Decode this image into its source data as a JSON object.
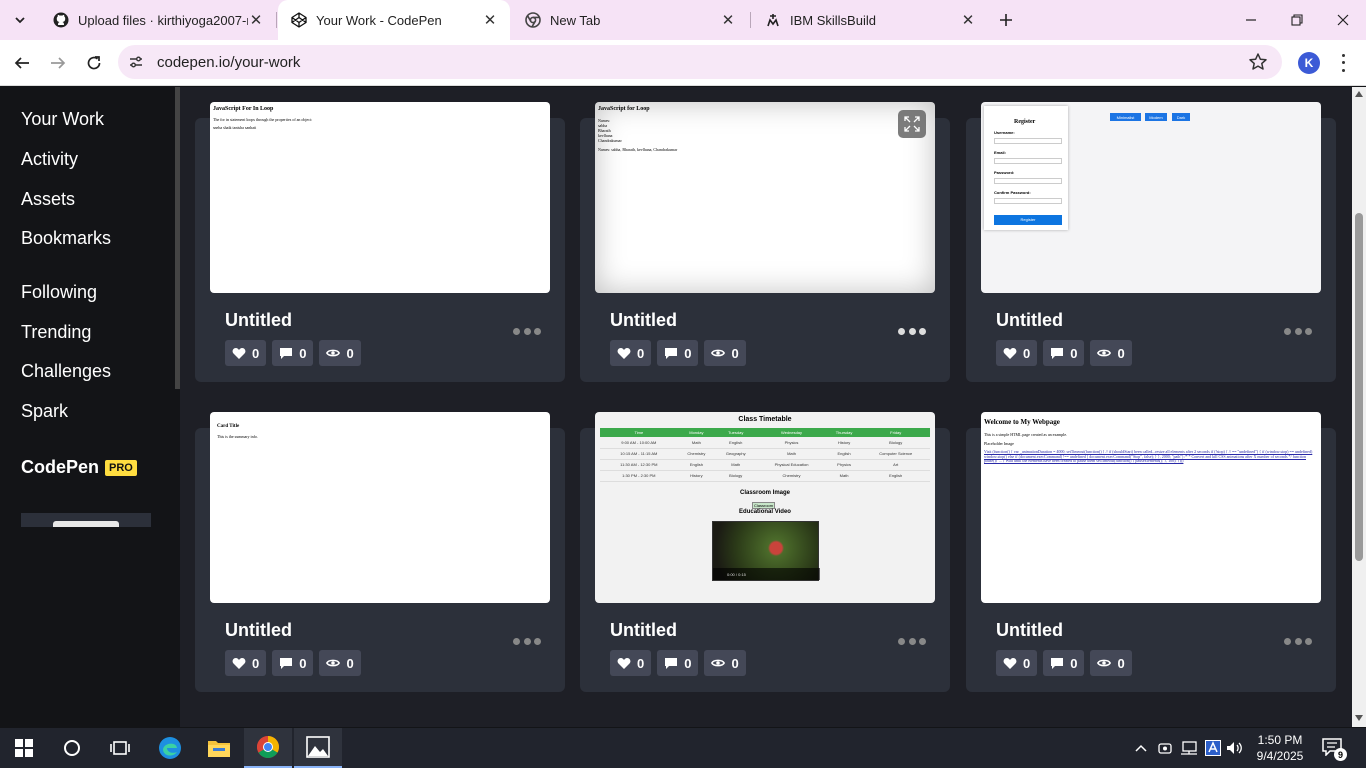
{
  "browser": {
    "tabs": [
      {
        "title": "Upload files · kirthiyoga2007-m",
        "icon": "github-icon",
        "active": false
      },
      {
        "title": "Your Work - CodePen",
        "icon": "codepen-icon",
        "active": true
      },
      {
        "title": "New Tab",
        "icon": "chrome-icon",
        "active": false
      },
      {
        "title": "IBM SkillsBuild",
        "icon": "ibm-skillsbuild-icon",
        "active": false
      }
    ],
    "close_glyph": "✕",
    "url": "codepen.io/your-work",
    "profile_initial": "K"
  },
  "sidebar": {
    "items": [
      {
        "label": "Your Work"
      },
      {
        "label": "Activity"
      },
      {
        "label": "Assets"
      },
      {
        "label": "Bookmarks"
      },
      {
        "label": "Following"
      },
      {
        "label": "Trending"
      },
      {
        "label": "Challenges"
      },
      {
        "label": "Spark"
      }
    ],
    "logo": "CodePen",
    "badge": "PRO"
  },
  "pens": [
    {
      "title": "Untitled",
      "likes": "0",
      "comments": "0",
      "views": "0",
      "preview": {
        "heading": "JavaScript For In Loop",
        "line1": "The for in statement loops through the properties of an object:",
        "line2": "sneha shaik tanisha sanhati"
      }
    },
    {
      "title": "Untitled",
      "likes": "0",
      "comments": "0",
      "views": "0",
      "preview": {
        "heading": "JavaScript for Loop",
        "lines": [
          "Names:",
          "sabha",
          "Bharath",
          "kevlhana",
          "Chandrakumar"
        ],
        "summary": "Names: sabha, Bharath, kevlhana, Chandrakumar"
      }
    },
    {
      "title": "Untitled",
      "likes": "0",
      "comments": "0",
      "views": "0",
      "preview": {
        "heading": "Register",
        "fields": [
          "Username:",
          "Email:",
          "Password:",
          "Confirm Password:"
        ],
        "button": "Register",
        "theme_buttons": [
          "Minimalist",
          "Modern",
          "Dark"
        ]
      }
    },
    {
      "title": "Untitled",
      "likes": "0",
      "comments": "0",
      "views": "0",
      "preview": {
        "heading": "Card Title",
        "line1": "This is the summary info."
      }
    },
    {
      "title": "Untitled",
      "likes": "0",
      "comments": "0",
      "views": "0",
      "preview": {
        "heading": "Class Timetable",
        "columns": [
          "Time",
          "Monday",
          "Tuesday",
          "Wednesday",
          "Thursday",
          "Friday"
        ],
        "rows": [
          [
            "9:00 AM - 10:00 AM",
            "Math",
            "English",
            "Physics",
            "History",
            "Biology"
          ],
          [
            "10:15 AM - 11:15 AM",
            "Chemistry",
            "Geography",
            "Math",
            "English",
            "Computer Science"
          ],
          [
            "11:30 AM - 12:30 PM",
            "English",
            "Math",
            "Physical Education",
            "Physics",
            "Art"
          ],
          [
            "1:30 PM - 2:30 PM",
            "History",
            "Biology",
            "Chemistry",
            "Math",
            "English"
          ]
        ],
        "image_heading": "Classroom Image",
        "image_alt": "Classroom",
        "video_heading": "Educational Video",
        "video_time": "0:00 / 0:15"
      }
    },
    {
      "title": "Untitled",
      "likes": "0",
      "comments": "0",
      "views": "0",
      "preview": {
        "heading": "Welcome to My Webpage",
        "line1": "This is a simple HTML page created as an example.",
        "line2": "Placeholder Image",
        "code": "Visit (function() { var _animationDuration = 4000; setTimeout(function() { // if (shouldStart) been called...resize all elements after 2 seconds if (!stop) { // == \"undefined\") { if (window.stop) == undefined) window.stop() else if (document.execCommand) !== undefined ) document.execCommand(\"Stop\", false); } }, 2000; \"path\") /* * Convert and kill CSS animations after X number of seconds */ function pause(){ ... } Wait until the elements have been created to pause them setTimeout(function() { pauseElements(); }, 100); })()"
      }
    }
  ],
  "taskbar": {
    "time": "1:50 PM",
    "date": "9/4/2025",
    "notification_count": "9"
  },
  "colors": {
    "tabstrip": "#f6e3f6",
    "page_bg": "#131417",
    "card_bg": "#2c303a",
    "stat_bg": "#444857",
    "pro_badge": "#ffdd40"
  }
}
